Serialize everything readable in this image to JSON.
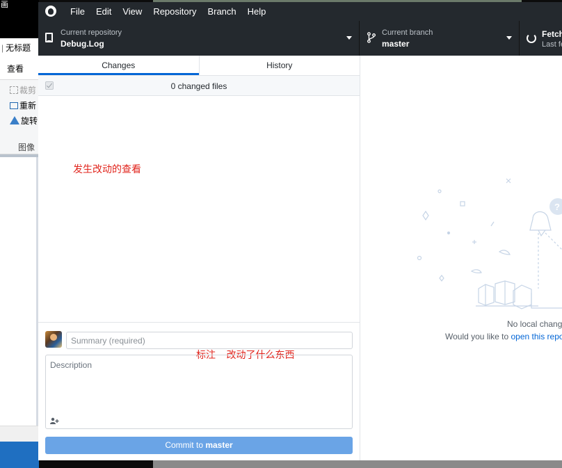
{
  "background_app": {
    "title_fragment": "画",
    "tab_fragment": "无标题",
    "ribbon_tab": "查看",
    "tools": [
      "裁剪",
      "重新",
      "旋转"
    ],
    "group_label": "图像"
  },
  "menubar": [
    "File",
    "Edit",
    "View",
    "Repository",
    "Branch",
    "Help"
  ],
  "toolbar": {
    "repo_label": "Current repository",
    "repo_value": "Debug.Log",
    "branch_label": "Current branch",
    "branch_value": "master",
    "fetch_value": "Fetch",
    "fetch_label": "Last fe"
  },
  "tabs": {
    "changes": "Changes",
    "history": "History"
  },
  "changes": {
    "count_text": "0 changed files"
  },
  "annotations": {
    "changes_note": "发生改动的查看",
    "commit_note": "标注    改动了什么东西"
  },
  "commit": {
    "summary_placeholder": "Summary (required)",
    "description_placeholder": "Description",
    "button_prefix": "Commit to ",
    "button_branch": "master"
  },
  "empty_state": {
    "title": "No local chang",
    "prompt": "Would you like to ",
    "link": "open this repo"
  },
  "colors": {
    "titlebar": "#24292e",
    "accent": "#0366d6",
    "commit_button": "#6aa4e6",
    "annotation": "#e1241c"
  }
}
